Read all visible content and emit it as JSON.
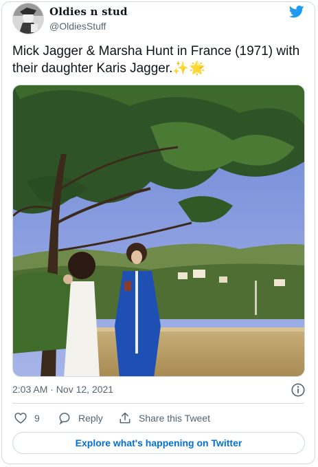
{
  "author": {
    "display_name": "Oldies n stud",
    "handle": "@OldiesStuff"
  },
  "tweet": {
    "text": "Mick Jagger & Marsha Hunt in France (1971) with their daughter Karis Jagger.✨🌟",
    "timestamp": "2:03 AM · Nov 12, 2021"
  },
  "actions": {
    "like_count": "9",
    "reply_label": "Reply",
    "share_label": "Share this Tweet"
  },
  "explore_label": "Explore what's happening on Twitter",
  "icons": [
    "twitter-bird-icon",
    "info-icon",
    "heart-icon",
    "reply-bubble-icon",
    "share-icon"
  ],
  "colors": {
    "twitter_blue": "#1d9bf0",
    "link_blue": "#006fd6",
    "secondary_text": "#536471",
    "border": "#cfd9de"
  }
}
